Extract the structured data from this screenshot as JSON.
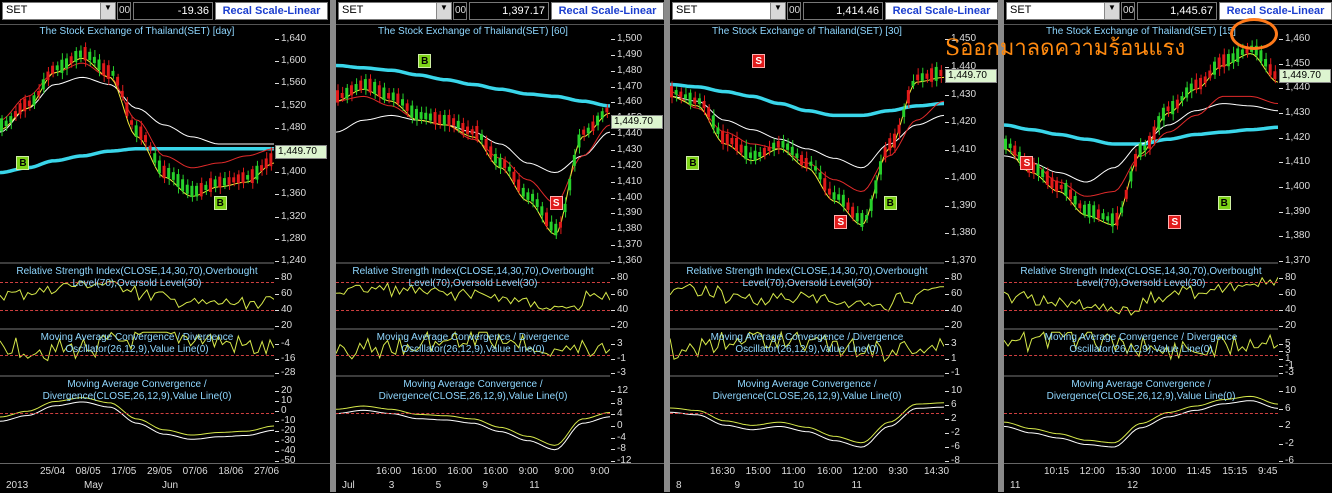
{
  "panels": [
    {
      "symbol": "SET",
      "channel": "00",
      "value": "-19.36",
      "recal": "Recal Scale-Linear",
      "title": "The Stock Exchange of Thailand(SET) [day]",
      "price_ticks": [
        "1,640",
        "1,600",
        "1,560",
        "1,520",
        "1,480",
        "1,440",
        "1,400",
        "1,360",
        "1,320",
        "1,280",
        "1,240"
      ],
      "last": "1,449.70",
      "rsi_title": "Relative Strength Index(CLOSE,14,30,70),Overbought Level(70),Oversold Level(30)",
      "rsi_ticks": [
        "80",
        "60",
        "40",
        "20"
      ],
      "osc_title": "Moving Average Convergence / Divergence Oscillator(26,12,9),Value Line(0)",
      "osc_ticks": [
        "-4",
        "-16",
        "-28"
      ],
      "macd_title": "Moving Average Convergence / Divergence(CLOSE,26,12,9),Value Line(0)",
      "macd_ticks": [
        "20",
        "10",
        "0",
        "-10",
        "-20",
        "-30",
        "-40",
        "-50"
      ],
      "x_row1": [
        "25/04",
        "08/05",
        "17/05",
        "29/05",
        "07/06",
        "18/06",
        "27/06"
      ],
      "x_row2": [
        "2013",
        "May",
        "Jun"
      ],
      "markers": [
        {
          "type": "B",
          "label": "B"
        },
        {
          "type": "B",
          "label": "B"
        }
      ]
    },
    {
      "symbol": "SET",
      "channel": "00",
      "value": "1,397.17",
      "recal": "Recal Scale-Linear",
      "title": "The Stock Exchange of Thailand(SET) [60]",
      "price_ticks": [
        "1,500",
        "1,490",
        "1,480",
        "1,470",
        "1,460",
        "1,450",
        "1,440",
        "1,430",
        "1,420",
        "1,410",
        "1,400",
        "1,390",
        "1,380",
        "1,370",
        "1,360"
      ],
      "last": "1,449.70",
      "rsi_title": "Relative Strength Index(CLOSE,14,30,70),Overbought Level(70),Oversold Level(30)",
      "rsi_ticks": [
        "80",
        "60",
        "40",
        "20"
      ],
      "osc_title": "Moving Average Convergence / Divergence Oscillator(26,12,9),Value Line(0)",
      "osc_ticks": [
        "3",
        "-1",
        "-3"
      ],
      "macd_title": "Moving Average Convergence / Divergence(CLOSE,26,12,9),Value Line(0)",
      "macd_ticks": [
        "12",
        "8",
        "4",
        "0",
        "-4",
        "-8",
        "-12"
      ],
      "x_row1": [
        "16:00",
        "16:00",
        "16:00",
        "16:00",
        "9:00",
        "9:00",
        "9:00"
      ],
      "x_row2": [
        "Jul",
        "3",
        "5",
        "9",
        "11"
      ],
      "markers": [
        {
          "type": "S",
          "label": "S"
        },
        {
          "type": "B",
          "label": "B"
        }
      ]
    },
    {
      "symbol": "SET",
      "channel": "00",
      "value": "1,414.46",
      "recal": "Recal Scale-Linear",
      "title": "The Stock Exchange of Thailand(SET) [30]",
      "price_ticks": [
        "1,450",
        "1,440",
        "1,430",
        "1,420",
        "1,410",
        "1,400",
        "1,390",
        "1,380",
        "1,370"
      ],
      "last": "1,449.70",
      "rsi_title": "Relative Strength Index(CLOSE,14,30,70),Overbought Level(70),Oversold Level(30)",
      "rsi_ticks": [
        "80",
        "60",
        "40",
        "20"
      ],
      "osc_title": "Moving Average Convergence / Divergence Oscillator(26,12,9),Value Line(0)",
      "osc_ticks": [
        "3",
        "1",
        "-1"
      ],
      "macd_title": "Moving Average Convergence / Divergence(CLOSE,26,12,9),Value Line(0)",
      "macd_ticks": [
        "10",
        "6",
        "2",
        "-2",
        "-6",
        "-8"
      ],
      "x_row1": [
        "16:30",
        "15:00",
        "11:00",
        "16:00",
        "12:00",
        "9:30",
        "14:30"
      ],
      "x_row2": [
        "8",
        "9",
        "10",
        "11"
      ],
      "markers": [
        {
          "type": "S",
          "label": "S"
        },
        {
          "type": "S",
          "label": "S"
        },
        {
          "type": "B",
          "label": "B"
        },
        {
          "type": "B",
          "label": "B"
        }
      ]
    },
    {
      "symbol": "SET",
      "channel": "00",
      "value": "1,445.67",
      "recal": "Recal Scale-Linear",
      "title": "The Stock Exchange of Thailand(SET) [15]",
      "price_ticks": [
        "1,460",
        "1,450",
        "1,440",
        "1,430",
        "1,420",
        "1,410",
        "1,400",
        "1,390",
        "1,380",
        "1,370"
      ],
      "last": "1,449.70",
      "rsi_title": "Relative Strength Index(CLOSE,14,30,70),Overbought Level(70),Oversold Level(30)",
      "rsi_ticks": [
        "80",
        "60",
        "40",
        "20"
      ],
      "osc_title": "Moving Average Convergence / Divergence Oscillator(26,12,9),Value Line(0)",
      "osc_ticks": [
        "5",
        "3",
        "1",
        "-1",
        "-3"
      ],
      "macd_title": "Moving Average Convergence / Divergence(CLOSE,26,12,9),Value Line(0)",
      "macd_ticks": [
        "10",
        "6",
        "2",
        "-2",
        "-6"
      ],
      "x_row1": [
        "10:15",
        "12:00",
        "15:30",
        "10:00",
        "11:45",
        "15:15",
        "9:45"
      ],
      "x_row2": [
        "11",
        "12"
      ],
      "markers": [
        {
          "type": "S",
          "label": "S"
        },
        {
          "type": "S",
          "label": "S"
        },
        {
          "type": "B",
          "label": "B"
        }
      ]
    }
  ],
  "annotation": "Sออกมาลดความร้อนแรง",
  "colors": {
    "ma_long": "#3ad6ea",
    "ma_mid": "#ffffff",
    "ma_short": "#f2ea3a",
    "ma_red": "#e02a2a",
    "up_candle": "#27d12b",
    "down_candle": "#e11a1a",
    "indicator": "#d6e84a",
    "axis_text": "#dddddd",
    "title_text": "#8fd7ff"
  }
}
